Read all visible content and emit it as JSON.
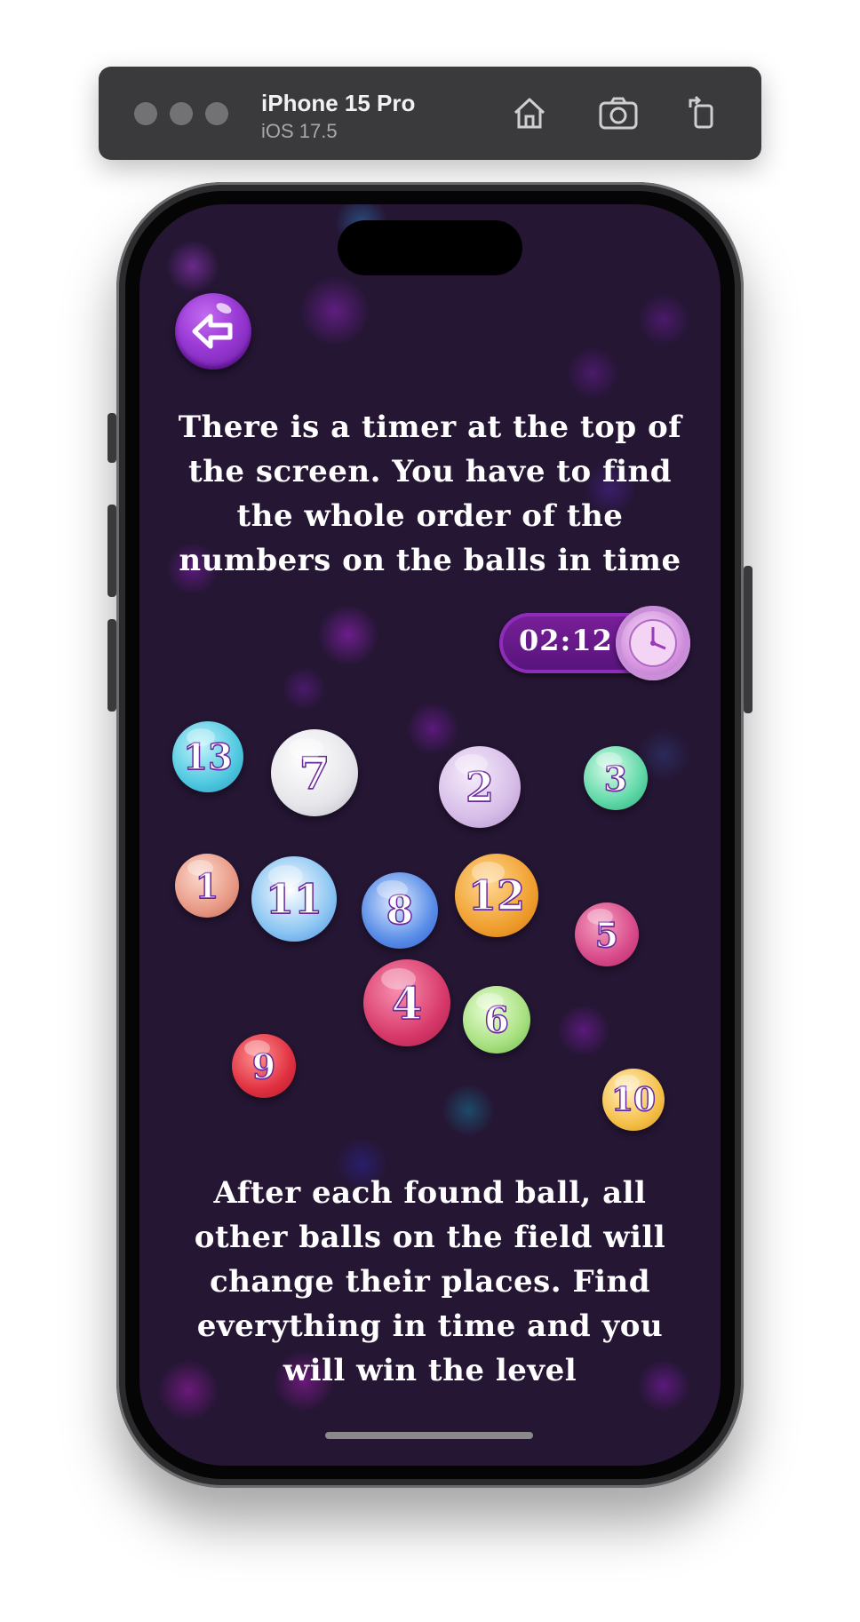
{
  "simulator": {
    "device_name": "iPhone 15 Pro",
    "os_version": "iOS 17.5",
    "window_dots": [
      "close",
      "minimize",
      "zoom"
    ],
    "toolbar_icons": [
      "home-icon",
      "screenshot-icon",
      "rotate-icon"
    ]
  },
  "game": {
    "back_icon": "back-arrow-icon",
    "intro_text": "There is a timer at the top of the screen. You have to find the whole order of the numbers on the balls in time",
    "timer": "02:12",
    "clock_icon": "clock-icon",
    "balls": [
      {
        "number": "13",
        "color": "#4fc8e0"
      },
      {
        "number": "7",
        "color": "#e6e6ea"
      },
      {
        "number": "2",
        "color": "#d6bde8"
      },
      {
        "number": "3",
        "color": "#5fd8a8"
      },
      {
        "number": "1",
        "color": "#e89a86"
      },
      {
        "number": "11",
        "color": "#8cc6f2"
      },
      {
        "number": "8",
        "color": "#5a8ee8"
      },
      {
        "number": "12",
        "color": "#f0a030"
      },
      {
        "number": "5",
        "color": "#d84a8a"
      },
      {
        "number": "4",
        "color": "#d83a6a"
      },
      {
        "number": "6",
        "color": "#a8e080"
      },
      {
        "number": "9",
        "color": "#e03040"
      },
      {
        "number": "10",
        "color": "#f5c04a"
      }
    ],
    "outro_text": "After each found ball, all other balls on the field will change their places. Find everything in time and you will win the level"
  }
}
